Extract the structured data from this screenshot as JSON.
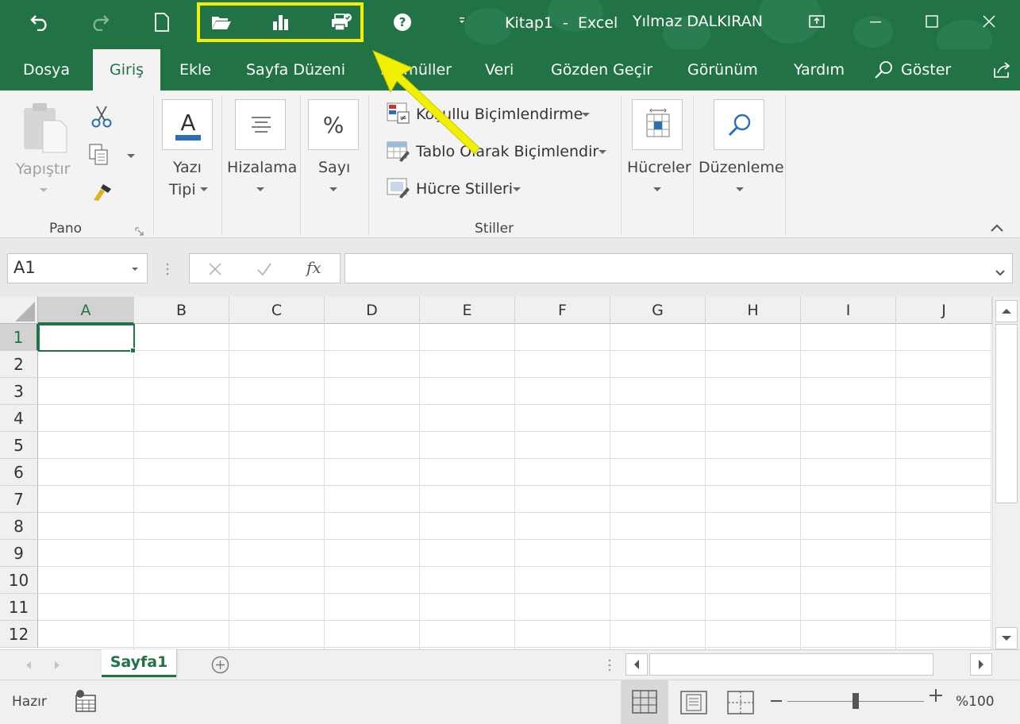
{
  "window": {
    "doc_title": "Kitap1  -  Excel",
    "user": "Yılmaz DALKIRAN"
  },
  "qat": {
    "icons": [
      "undo-icon",
      "redo-icon",
      "new-file-icon",
      "open-folder-icon",
      "chart-icon",
      "quick-print-icon",
      "help-icon",
      "customize-qat-icon"
    ],
    "highlight_color": "#f0f000"
  },
  "tabs": [
    "Dosya",
    "Giriş",
    "Ekle",
    "Sayfa Düzeni",
    "Formüller",
    "Veri",
    "Gözden Geçir",
    "Görünüm",
    "Yardım"
  ],
  "tell_me": "Göster",
  "ribbon": {
    "paste_label": "Yapıştır",
    "clipboard_group": "Pano",
    "font_label_1": "Yazı",
    "font_label_2": "Tipi",
    "align_label": "Hizalama",
    "number_label": "Sayı",
    "number_icon_text": "%",
    "styles": [
      "Koşullu Biçimlendirme",
      "Tablo Olarak Biçimlendir",
      "Hücre Stilleri"
    ],
    "styles_group": "Stiller",
    "cells_label": "Hücreler",
    "editing_label": "Düzenleme"
  },
  "formula_bar": {
    "name_box": "A1",
    "fx": "fx",
    "formula": ""
  },
  "columns": [
    "A",
    "B",
    "C",
    "D",
    "E",
    "F",
    "G",
    "H",
    "I",
    "J"
  ],
  "rows": [
    "1",
    "2",
    "3",
    "4",
    "5",
    "6",
    "7",
    "8",
    "9",
    "10",
    "11",
    "12"
  ],
  "active_cell": "A1",
  "sheet_tabs": [
    "Sayfa1"
  ],
  "status": {
    "ready": "Hazır",
    "zoom": "%100",
    "zoom_fraction": 0.5
  },
  "colors": {
    "brand": "#217346",
    "arrow": "#f0f000"
  }
}
